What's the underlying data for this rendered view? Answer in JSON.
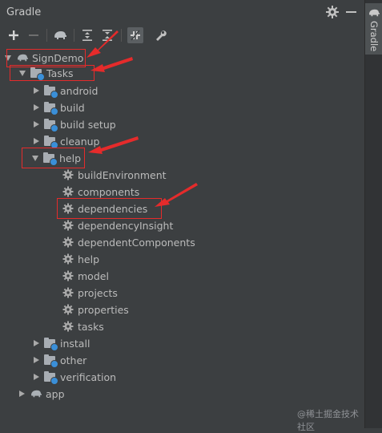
{
  "panel": {
    "title": "Gradle",
    "side_tab_label": "Gradle",
    "watermark": "@稀土掘金技术社区"
  },
  "toolbar": {
    "buttons": [
      "add-icon",
      "remove-icon",
      "elephant-icon",
      "expand-all-icon",
      "collapse-all-icon",
      "toggle-offline-icon",
      "settings-wrench-icon"
    ]
  },
  "tree": {
    "root": "SignDemo",
    "tasks": "Tasks",
    "groups": {
      "android": "android",
      "build": "build",
      "build_setup": "build setup",
      "cleanup": "cleanup",
      "help": "help",
      "install": "install",
      "other": "other",
      "verification": "verification"
    },
    "help_tasks": {
      "buildEnvironment": "buildEnvironment",
      "components": "components",
      "dependencies": "dependencies",
      "dependencyInsight": "dependencyInsight",
      "dependentComponents": "dependentComponents",
      "help": "help",
      "model": "model",
      "projects": "projects",
      "properties": "properties",
      "tasks": "tasks"
    },
    "app": "app"
  },
  "colors": {
    "background": "#3c3f41",
    "text": "#bbbbbb",
    "annotation": "#e52b2b",
    "task_gear_accent": "#3a8fd8"
  }
}
